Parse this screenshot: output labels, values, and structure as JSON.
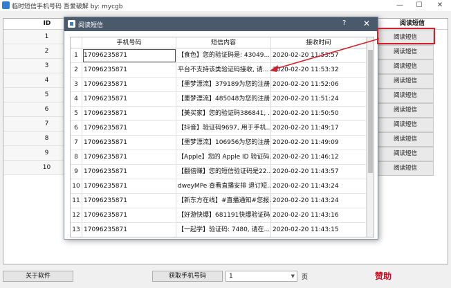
{
  "window": {
    "title": "临时短信手机号码 吾爱破解 by: mycgb",
    "minimize": "—",
    "maximize": "☐",
    "close": "✕"
  },
  "grid": {
    "col_id": "ID",
    "col_action": "阅读短信",
    "rows": [
      {
        "id": "1",
        "action": "阅读短信"
      },
      {
        "id": "2",
        "action": "阅读短信"
      },
      {
        "id": "3",
        "action": "阅读短信"
      },
      {
        "id": "4",
        "action": "阅读短信"
      },
      {
        "id": "5",
        "action": "阅读短信"
      },
      {
        "id": "6",
        "action": "阅读短信"
      },
      {
        "id": "7",
        "action": "阅读短信"
      },
      {
        "id": "8",
        "action": "阅读短信"
      },
      {
        "id": "9",
        "action": "阅读短信"
      },
      {
        "id": "10",
        "action": "阅读短信"
      }
    ]
  },
  "dialog": {
    "title": "阅读短信",
    "help": "?",
    "close": "✕",
    "headers": [
      "手机号码",
      "短信内容",
      "接收时间"
    ],
    "rows": [
      {
        "n": "1",
        "phone": "17096235871",
        "content": "【食色】您的验证码是: 43049...",
        "time": "2020-02-20 11:53:57"
      },
      {
        "n": "2",
        "phone": "17096235871",
        "content": "平台不支持该类验证码接收, 请...",
        "time": "2020-02-20 11:53:32"
      },
      {
        "n": "3",
        "phone": "17096235871",
        "content": "【墨梦漂流】379189为您的注册...",
        "time": "2020-02-20 11:52:06"
      },
      {
        "n": "4",
        "phone": "17096235871",
        "content": "【墨梦漂流】485048为您的注册...",
        "time": "2020-02-20 11:51:24"
      },
      {
        "n": "5",
        "phone": "17096235871",
        "content": "【美买家】您的验证码386841, ...",
        "time": "2020-02-20 11:50:50"
      },
      {
        "n": "6",
        "phone": "17096235871",
        "content": "【抖音】验证码9697, 用于手机...",
        "time": "2020-02-20 11:49:17"
      },
      {
        "n": "7",
        "phone": "17096235871",
        "content": "【墨梦漂流】106956为您的注册...",
        "time": "2020-02-20 11:49:09"
      },
      {
        "n": "8",
        "phone": "17096235871",
        "content": "【Apple】您的 Apple ID 验证码...",
        "time": "2020-02-20 11:46:12"
      },
      {
        "n": "9",
        "phone": "17096235871",
        "content": "【翻倍赚】您的短信验证码是22...",
        "time": "2020-02-20 11:43:57"
      },
      {
        "n": "10",
        "phone": "17096235871",
        "content": "dweyMPe 查看直播安排 退订短...",
        "time": "2020-02-20 11:43:24"
      },
      {
        "n": "11",
        "phone": "17096235871",
        "content": "【新东方在线】#直播通知#您报...",
        "time": "2020-02-20 11:43:24"
      },
      {
        "n": "12",
        "phone": "17096235871",
        "content": "【好游快爆】681191快爆验证码...",
        "time": "2020-02-20 11:43:16"
      },
      {
        "n": "13",
        "phone": "17096235871",
        "content": "【一起学】验证码: 7480, 请在...",
        "time": "2020-02-20 11:43:15"
      }
    ]
  },
  "bottom": {
    "about": "关于软件",
    "get_numbers": "获取手机号码",
    "page_value": "1",
    "page_label": "页",
    "donate": "赞助"
  },
  "colors": {
    "annotation": "#d0202a",
    "dialog_titlebar": "#4a5a6b",
    "donate": "#d9001b"
  }
}
